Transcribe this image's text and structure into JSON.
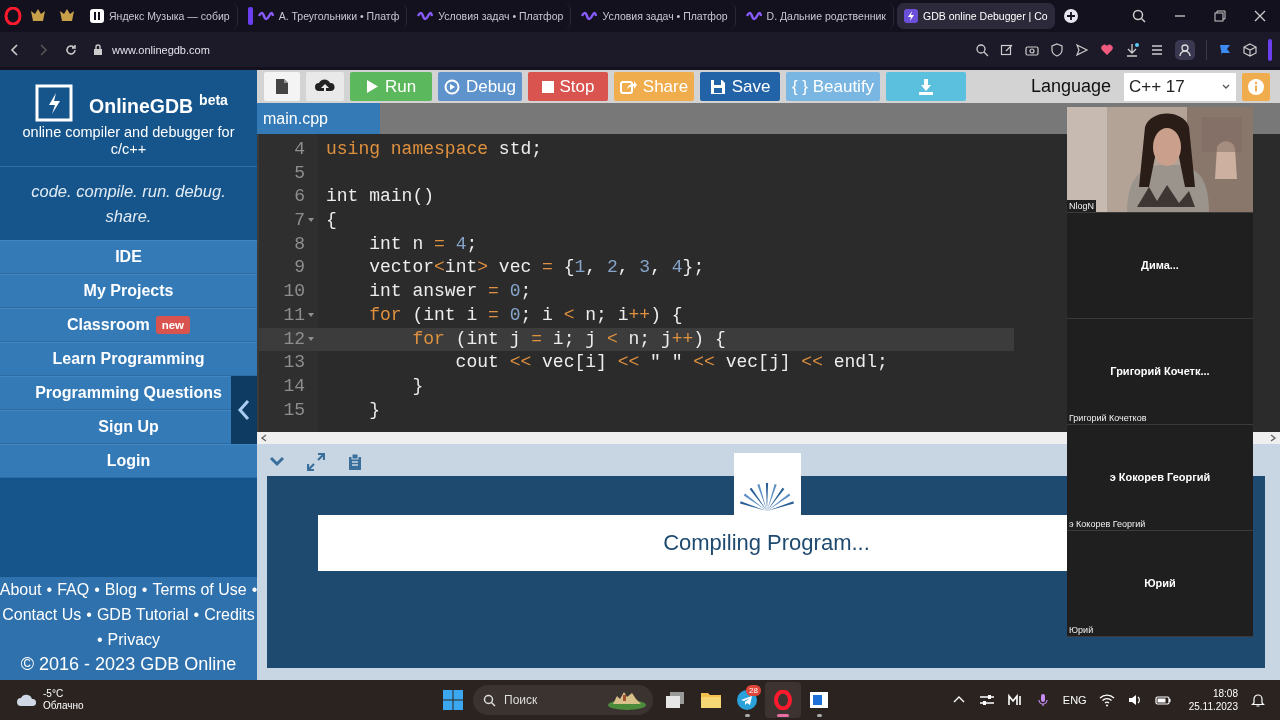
{
  "browser": {
    "tabs": [
      {
        "kind": "pinned",
        "selected": false,
        "grouped": false
      },
      {
        "kind": "pinned",
        "selected": false,
        "grouped": false
      },
      {
        "kind": "music",
        "title": "Яндекс Музыка — собир",
        "selected": false,
        "grouped": false
      },
      {
        "kind": "platform",
        "title": "А. Треугольники • Платф",
        "selected": false,
        "grouped": true
      },
      {
        "kind": "platform",
        "title": "Условия задач • Платфор",
        "selected": false,
        "grouped": false
      },
      {
        "kind": "platform",
        "title": "Условия задач • Платфор",
        "selected": false,
        "grouped": false
      },
      {
        "kind": "platform",
        "title": "D. Дальние родственник",
        "selected": false,
        "grouped": false
      },
      {
        "kind": "gdb",
        "title": "GDB online Debugger | Co",
        "selected": true,
        "grouped": false
      }
    ],
    "address": "www.onlinegdb.com"
  },
  "sidebar": {
    "brand": "OnlineGDB",
    "brand_badge": "beta",
    "subtitle": "online compiler and debugger for c/c++",
    "tagline": "code. compile. run. debug. share.",
    "menu": [
      {
        "label": "IDE"
      },
      {
        "label": "My Projects"
      },
      {
        "label": "Classroom",
        "badge": "new"
      },
      {
        "label": "Learn Programming"
      },
      {
        "label": "Programming Questions"
      },
      {
        "label": "Sign Up"
      },
      {
        "label": "Login"
      }
    ],
    "separator": "•",
    "footer_lines": [
      [
        {
          "text": "About",
          "separator_before": false,
          "separator_after": true
        },
        {
          "text": "FAQ",
          "separator_before": false,
          "separator_after": true
        },
        {
          "text": "Blog",
          "separator_before": false,
          "separator_after": true
        },
        {
          "text": "Terms of Use",
          "separator_before": false,
          "separator_after": true
        }
      ],
      [
        {
          "text": "Contact Us",
          "separator_before": false,
          "separator_after": true
        },
        {
          "text": "GDB Tutorial",
          "separator_before": false,
          "separator_after": true
        },
        {
          "text": "Credits",
          "separator_before": false,
          "separator_after": false
        }
      ],
      [
        {
          "text": "Privacy",
          "separator_before": true,
          "separator_after": false
        }
      ]
    ],
    "copyright": "© 2016 - 2023 GDB Online"
  },
  "toolbar": {
    "buttons": [
      {
        "kind": "new-file"
      },
      {
        "kind": "upload"
      },
      {
        "kind": "run",
        "label": "Run"
      },
      {
        "kind": "debug",
        "label": "Debug"
      },
      {
        "kind": "stop",
        "label": "Stop"
      },
      {
        "kind": "share",
        "label": "Share"
      },
      {
        "kind": "save",
        "label": "Save"
      },
      {
        "kind": "beautify",
        "label": "{ } Beautify"
      },
      {
        "kind": "download"
      }
    ],
    "language_label": "Language",
    "language": "C++ 17"
  },
  "editor": {
    "file_tab": "main.cpp",
    "lines": [
      {
        "number": "4",
        "fold": false,
        "active": false,
        "tokens": [
          {
            "kind": "kw",
            "text": "using"
          },
          {
            "kind": "kw",
            "text": " namespace"
          },
          {
            "kind": "plain",
            "text": " std;"
          }
        ]
      },
      {
        "number": "5",
        "fold": false,
        "active": false
      },
      {
        "number": "6",
        "fold": false,
        "active": false,
        "tokens": [
          {
            "kind": "plain",
            "text": "int main()"
          }
        ]
      },
      {
        "number": "7",
        "fold": true,
        "active": false,
        "tokens": [
          {
            "kind": "plain",
            "text": "{"
          }
        ]
      },
      {
        "number": "8",
        "fold": false,
        "active": false,
        "tokens": [
          {
            "kind": "plain",
            "text": "    int n "
          },
          {
            "kind": "op",
            "text": "= "
          },
          {
            "kind": "num",
            "text": "4"
          },
          {
            "kind": "plain",
            "text": ";"
          }
        ]
      },
      {
        "number": "9",
        "fold": false,
        "active": false,
        "tokens": [
          {
            "kind": "plain",
            "text": "    vector"
          },
          {
            "kind": "op",
            "text": "<"
          },
          {
            "kind": "plain",
            "text": "int"
          },
          {
            "kind": "op",
            "text": ">"
          },
          {
            "kind": "plain",
            "text": " vec "
          },
          {
            "kind": "op",
            "text": "="
          },
          {
            "kind": "plain",
            "text": " {"
          },
          {
            "kind": "num",
            "text": "1"
          },
          {
            "kind": "plain",
            "text": ", "
          },
          {
            "kind": "num",
            "text": "2"
          },
          {
            "kind": "plain",
            "text": ", "
          },
          {
            "kind": "num",
            "text": "3"
          },
          {
            "kind": "plain",
            "text": ", "
          },
          {
            "kind": "num",
            "text": "4"
          },
          {
            "kind": "plain",
            "text": "};"
          }
        ]
      },
      {
        "number": "10",
        "fold": false,
        "active": false,
        "tokens": [
          {
            "kind": "plain",
            "text": "    int answer "
          },
          {
            "kind": "op",
            "text": "= "
          },
          {
            "kind": "num",
            "text": "0"
          },
          {
            "kind": "plain",
            "text": ";"
          }
        ]
      },
      {
        "number": "11",
        "fold": true,
        "active": false,
        "tokens": [
          {
            "kind": "kw",
            "text": "    for"
          },
          {
            "kind": "plain",
            "text": " (int i "
          },
          {
            "kind": "op",
            "text": "= "
          },
          {
            "kind": "num",
            "text": "0"
          },
          {
            "kind": "plain",
            "text": "; i "
          },
          {
            "kind": "op",
            "text": "<"
          },
          {
            "kind": "plain",
            "text": " n; i"
          },
          {
            "kind": "op",
            "text": "++"
          },
          {
            "kind": "plain",
            "text": ") {"
          }
        ]
      },
      {
        "number": "12",
        "fold": true,
        "active": true,
        "tokens": [
          {
            "kind": "kw",
            "text": "        for"
          },
          {
            "kind": "plain",
            "text": " (int j "
          },
          {
            "kind": "op",
            "text": "="
          },
          {
            "kind": "plain",
            "text": " i; j "
          },
          {
            "kind": "op",
            "text": "<"
          },
          {
            "kind": "plain",
            "text": " n; j"
          },
          {
            "kind": "op",
            "text": "++"
          },
          {
            "kind": "plain",
            "text": ") {"
          }
        ]
      },
      {
        "number": "13",
        "fold": false,
        "active": false,
        "tokens": [
          {
            "kind": "plain",
            "text": "            cout "
          },
          {
            "kind": "op",
            "text": "<<"
          },
          {
            "kind": "plain",
            "text": " vec[i] "
          },
          {
            "kind": "op",
            "text": "<<"
          },
          {
            "kind": "plain",
            "text": " \" \" "
          },
          {
            "kind": "op",
            "text": "<<"
          },
          {
            "kind": "plain",
            "text": " vec[j] "
          },
          {
            "kind": "op",
            "text": "<<"
          },
          {
            "kind": "plain",
            "text": " endl;"
          }
        ]
      },
      {
        "number": "14",
        "fold": false,
        "active": false,
        "tokens": [
          {
            "kind": "plain",
            "text": "        }"
          }
        ]
      },
      {
        "number": "15",
        "fold": false,
        "active": false,
        "tokens": [
          {
            "kind": "plain",
            "text": "    }"
          }
        ]
      }
    ]
  },
  "output": {
    "message": "Compiling Program..."
  },
  "video_call": {
    "tiles": [
      {
        "kind": "camera",
        "caption": "NlogN"
      },
      {
        "kind": "avatar",
        "display_name": "Дима..."
      },
      {
        "kind": "avatar",
        "display_name": "Григорий  Кочетк...",
        "caption": "Григорий Кочетков"
      },
      {
        "kind": "avatar",
        "display_name": "э Кокорев Георгий",
        "caption": "э Кокорев Георгий"
      },
      {
        "kind": "avatar",
        "display_name": "Юрий",
        "caption": "Юрий"
      }
    ]
  },
  "taskbar": {
    "temperature": "-5°C",
    "condition": "Облачно",
    "search_placeholder": "Поиск",
    "apps": [
      {
        "kind": "task-view",
        "running": false,
        "active": false
      },
      {
        "kind": "folder",
        "running": false,
        "active": false
      },
      {
        "kind": "telegram",
        "badge": "28",
        "running": true,
        "active": false
      },
      {
        "kind": "browser",
        "running": true,
        "active": true
      },
      {
        "kind": "window-app",
        "running": true,
        "active": false
      }
    ],
    "language": "ENG",
    "time": "18:08",
    "date": "25.11.2023"
  }
}
